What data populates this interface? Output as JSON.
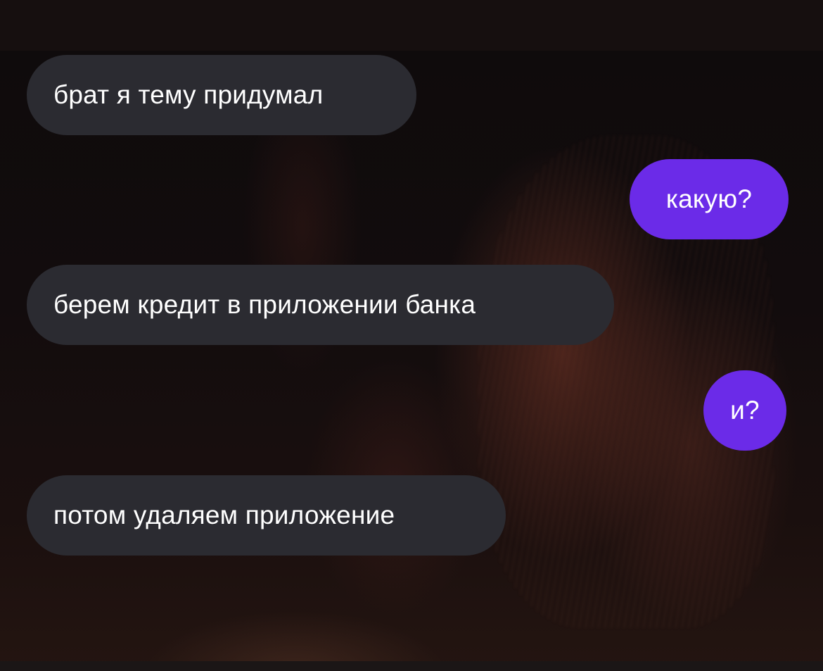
{
  "chat": {
    "messages": [
      {
        "text": "брат я тему придумал",
        "direction": "incoming"
      },
      {
        "text": "какую?",
        "direction": "outgoing"
      },
      {
        "text": "берем кредит в приложении банка",
        "direction": "incoming"
      },
      {
        "text": "и?",
        "direction": "outgoing"
      },
      {
        "text": "потом удаляем приложение",
        "direction": "incoming"
      }
    ]
  },
  "colors": {
    "incoming_bubble": "#2b2b31",
    "outgoing_bubble": "#6b2be8",
    "text": "#ffffff",
    "background": "#140e0e"
  }
}
